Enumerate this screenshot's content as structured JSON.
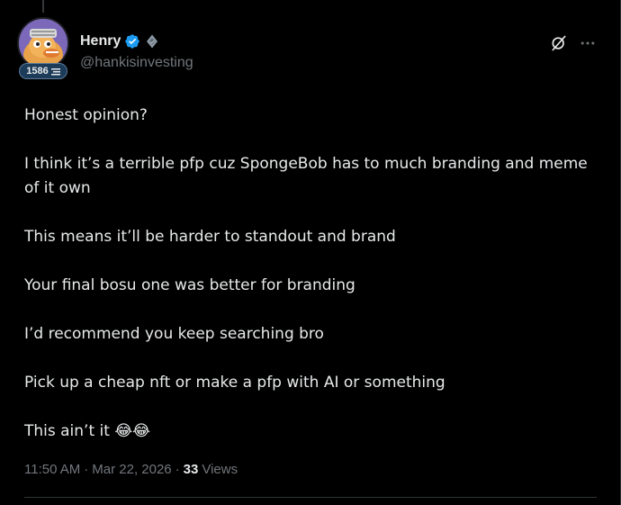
{
  "author": {
    "display_name": "Henry",
    "handle": "@hankisinvesting",
    "badge_count": "1586"
  },
  "tweet": {
    "paragraphs": [
      "Honest opinion?",
      "I think it’s a terrible pfp cuz SpongeBob has to much branding and meme of it own",
      "This means it’ll be harder to standout and brand",
      "Your final bosu one was better for branding",
      "I’d recommend you keep searching bro",
      "Pick up a cheap nft or make a pfp with AI or something",
      "This ain’t it 😂😂"
    ]
  },
  "meta": {
    "time": "11:50 AM",
    "separator": "·",
    "date": "Mar 22, 2026",
    "views_count": "33",
    "views_label": "Views"
  },
  "colors": {
    "background": "#000000",
    "text_primary": "#e7e9ea",
    "text_secondary": "#71767b",
    "verified_blue": "#1d9bf0",
    "border": "#2f3336"
  },
  "icons": {
    "verified": "verified-badge-icon",
    "affiliate": "affiliate-badge-icon",
    "grok": "grok-icon",
    "more": "more-options-icon"
  }
}
